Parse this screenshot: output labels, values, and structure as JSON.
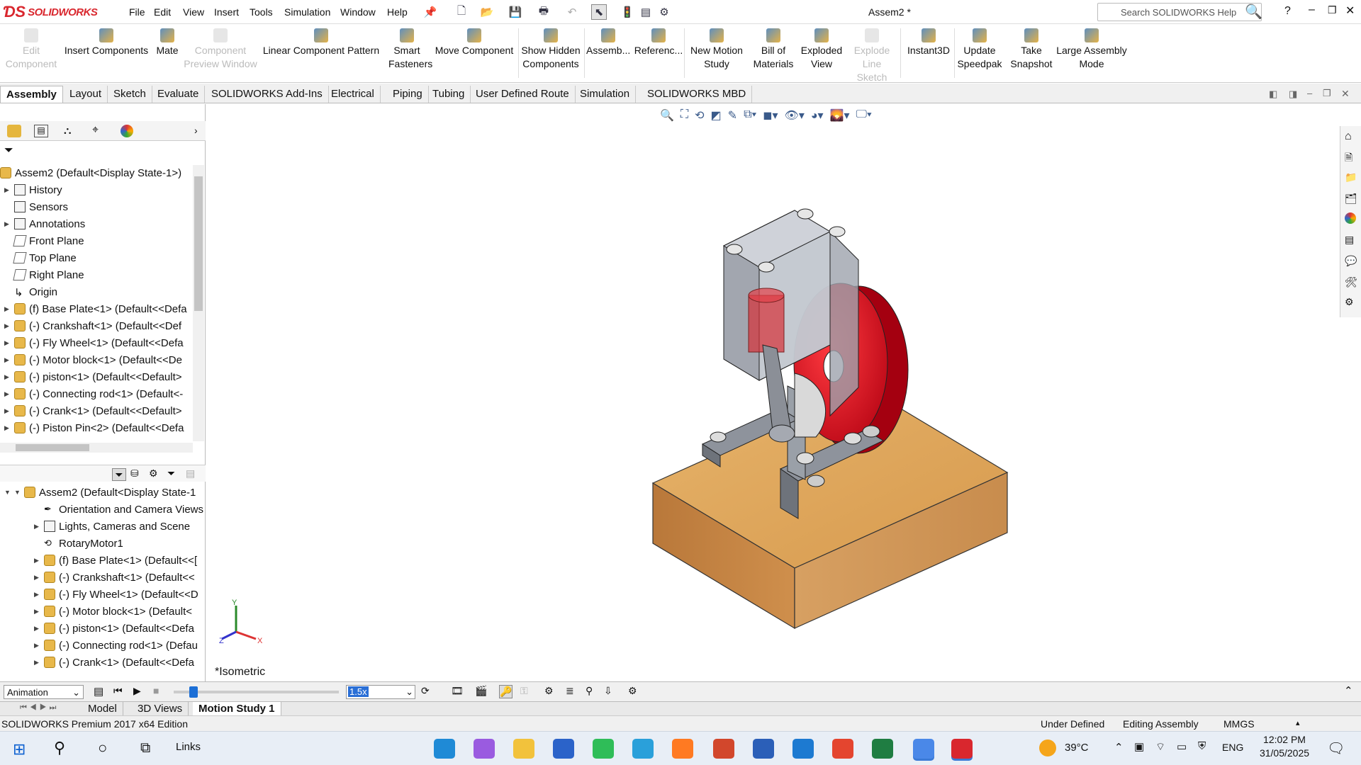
{
  "app": {
    "brand": "SOLIDWORKS",
    "doc_title": "Assem2 *"
  },
  "menu": [
    "File",
    "Edit",
    "View",
    "Insert",
    "Tools",
    "Simulation",
    "Window",
    "Help"
  ],
  "search": {
    "placeholder": "Search SOLIDWORKS Help"
  },
  "commands": [
    {
      "label1": "Edit",
      "label2": "Component",
      "disabled": true,
      "icon": "edit-component-icon"
    },
    {
      "label1": "Insert Components",
      "label2": "",
      "disabled": false,
      "icon": "insert-components-icon"
    },
    {
      "label1": "Mate",
      "label2": "",
      "disabled": false,
      "icon": "paperclip-icon"
    },
    {
      "label1": "Component",
      "label2": "Preview Window",
      "disabled": true,
      "icon": "preview-window-icon"
    },
    {
      "label1": "Linear Component Pattern",
      "label2": "",
      "disabled": false,
      "icon": "pattern-icon"
    },
    {
      "label1": "Smart",
      "label2": "Fasteners",
      "disabled": false,
      "icon": "fastener-icon"
    },
    {
      "label1": "Move Component",
      "label2": "",
      "disabled": false,
      "icon": "move-component-icon"
    },
    {
      "label1": "Show Hidden",
      "label2": "Components",
      "disabled": false,
      "icon": "show-hidden-icon"
    },
    {
      "label1": "Assemb...",
      "label2": "",
      "disabled": false,
      "icon": "assembly-features-icon"
    },
    {
      "label1": "Referenc...",
      "label2": "",
      "disabled": false,
      "icon": "reference-geometry-icon"
    },
    {
      "label1": "New Motion",
      "label2": "Study",
      "disabled": false,
      "icon": "motion-study-icon"
    },
    {
      "label1": "Bill of",
      "label2": "Materials",
      "disabled": false,
      "icon": "bom-icon"
    },
    {
      "label1": "Exploded",
      "label2": "View",
      "disabled": false,
      "icon": "exploded-view-icon"
    },
    {
      "label1": "Explode",
      "label2": "Line Sketch",
      "disabled": true,
      "icon": "explode-line-icon"
    },
    {
      "label1": "Instant3D",
      "label2": "",
      "disabled": false,
      "icon": "instant3d-icon"
    },
    {
      "label1": "Update",
      "label2": "Speedpak",
      "disabled": false,
      "icon": "speedpak-icon"
    },
    {
      "label1": "Take",
      "label2": "Snapshot",
      "disabled": false,
      "icon": "camera-icon"
    },
    {
      "label1": "Large Assembly",
      "label2": "Mode",
      "disabled": false,
      "icon": "large-assembly-icon"
    }
  ],
  "tabs": [
    "Assembly",
    "Layout",
    "Sketch",
    "Evaluate",
    "SOLIDWORKS Add-Ins",
    "Electrical",
    "Piping",
    "Tubing",
    "User Defined Route",
    "Simulation",
    "SOLIDWORKS MBD"
  ],
  "feature_tree": {
    "root": "Assem2  (Default<Display State-1>)",
    "items": [
      {
        "label": "History",
        "type": "folder",
        "expand": true
      },
      {
        "label": "Sensors",
        "type": "folder",
        "expand": false
      },
      {
        "label": "Annotations",
        "type": "folder",
        "expand": true
      },
      {
        "label": "Front Plane",
        "type": "plane",
        "expand": false
      },
      {
        "label": "Top Plane",
        "type": "plane",
        "expand": false
      },
      {
        "label": "Right Plane",
        "type": "plane",
        "expand": false
      },
      {
        "label": "Origin",
        "type": "origin",
        "expand": false
      },
      {
        "label": "(f) Base Plate<1> (Default<<Defa",
        "type": "part",
        "expand": true
      },
      {
        "label": "(-) Crankshaft<1> (Default<<Def",
        "type": "part",
        "expand": true
      },
      {
        "label": "(-) Fly Wheel<1> (Default<<Defa",
        "type": "part",
        "expand": true
      },
      {
        "label": "(-) Motor block<1> (Default<<De",
        "type": "part",
        "expand": true
      },
      {
        "label": "(-) piston<1> (Default<<Default>",
        "type": "part",
        "expand": true
      },
      {
        "label": "(-) Connecting rod<1> (Default<-",
        "type": "part",
        "expand": true
      },
      {
        "label": "(-) Crank<1> (Default<<Default>",
        "type": "part",
        "expand": true
      },
      {
        "label": "(-) Piston Pin<2> (Default<<Defa",
        "type": "part",
        "expand": true
      }
    ]
  },
  "motion_tree": {
    "root": "Assem2  (Default<Display State-1",
    "items": [
      {
        "label": "Orientation and Camera Views",
        "type": "camera",
        "expand": false
      },
      {
        "label": "Lights, Cameras and Scene",
        "type": "lights",
        "expand": true
      },
      {
        "label": "RotaryMotor1",
        "type": "motor",
        "expand": false
      },
      {
        "label": "(f) Base Plate<1> (Default<<[",
        "type": "part",
        "expand": true
      },
      {
        "label": "(-) Crankshaft<1> (Default<<",
        "type": "part",
        "expand": true
      },
      {
        "label": "(-) Fly Wheel<1> (Default<<D",
        "type": "part",
        "expand": true
      },
      {
        "label": "(-) Motor block<1> (Default<",
        "type": "part",
        "expand": true
      },
      {
        "label": "(-) piston<1> (Default<<Defa",
        "type": "part",
        "expand": true
      },
      {
        "label": "(-) Connecting rod<1> (Defau",
        "type": "part",
        "expand": true
      },
      {
        "label": "(-) Crank<1> (Default<<Defa",
        "type": "part",
        "expand": true
      }
    ]
  },
  "viewport": {
    "view_label": "*Isometric",
    "triad": {
      "x": "X",
      "y": "Y",
      "z": "Z"
    }
  },
  "motion_bar": {
    "study_type": "Animation",
    "speed": "1.5x",
    "timeline_position": 0.12
  },
  "bottom_tabs": [
    "Model",
    "3D Views",
    "Motion Study 1"
  ],
  "status": {
    "edition": "SOLIDWORKS Premium 2017 x64 Edition",
    "state1": "Under Defined",
    "state2": "Editing Assembly",
    "units": "MMGS"
  },
  "taskbar": {
    "links": "Links",
    "temp": "39°C",
    "lang": "ENG",
    "time": "12:02 PM",
    "date": "31/05/2025"
  },
  "colors": {
    "accent": "#d9272e",
    "flywheel": "#e8121c",
    "base": "#d89a4e",
    "block": "#9fa3ad"
  }
}
